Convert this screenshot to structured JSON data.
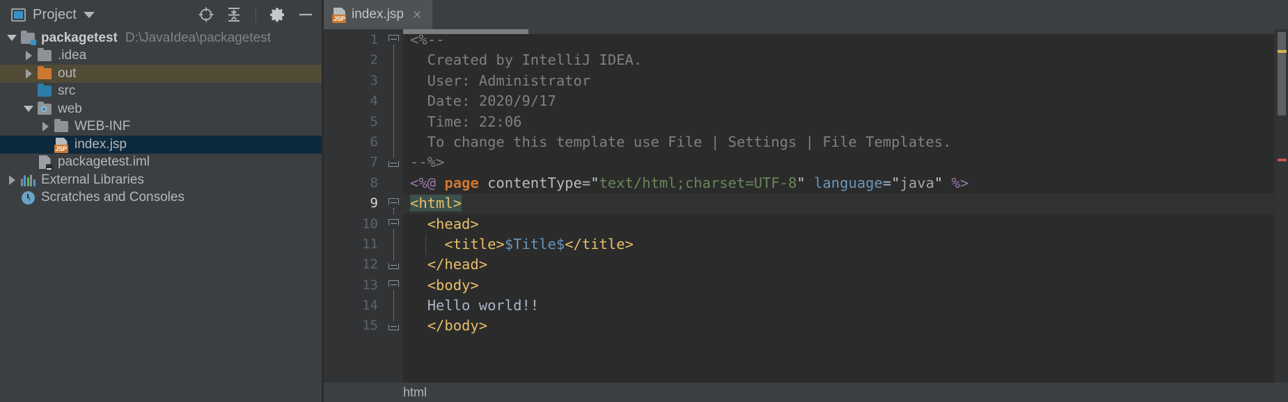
{
  "project_panel": {
    "title": "Project",
    "window_icon": "project-window-icon",
    "actions": [
      {
        "name": "locate-icon",
        "label": "Select Opened File"
      },
      {
        "name": "collapse-all-icon",
        "label": "Collapse All"
      },
      {
        "name": "gear-icon",
        "label": "Settings"
      },
      {
        "name": "minimize-icon",
        "label": "Hide"
      }
    ],
    "tree": [
      {
        "label": "packagetest",
        "path": "D:\\JavaIdea\\packagetest",
        "icon": "module-folder-icon",
        "arrow": "down",
        "depth": 0,
        "bold": true,
        "state": "none"
      },
      {
        "label": ".idea",
        "path": "",
        "icon": "folder-gray-icon",
        "arrow": "right",
        "depth": 1,
        "bold": false,
        "state": "none"
      },
      {
        "label": "out",
        "path": "",
        "icon": "folder-orange-icon",
        "arrow": "right",
        "depth": 1,
        "bold": false,
        "state": "hover"
      },
      {
        "label": "src",
        "path": "",
        "icon": "folder-blue-icon",
        "arrow": "none",
        "depth": 1,
        "bold": false,
        "state": "none"
      },
      {
        "label": "web",
        "path": "",
        "icon": "folder-web-icon",
        "arrow": "down",
        "depth": 1,
        "bold": false,
        "state": "none"
      },
      {
        "label": "WEB-INF",
        "path": "",
        "icon": "folder-gray-icon",
        "arrow": "right",
        "depth": 2,
        "bold": false,
        "state": "none"
      },
      {
        "label": "index.jsp",
        "path": "",
        "icon": "jsp-file-icon",
        "arrow": "none",
        "depth": 2,
        "bold": false,
        "state": "selected"
      },
      {
        "label": "packagetest.iml",
        "path": "",
        "icon": "iml-file-icon",
        "arrow": "none",
        "depth": 1,
        "bold": false,
        "state": "none"
      },
      {
        "label": "External Libraries",
        "path": "",
        "icon": "library-icon",
        "arrow": "right",
        "depth": 0,
        "bold": false,
        "state": "none"
      },
      {
        "label": "Scratches and Consoles",
        "path": "",
        "icon": "scratches-icon",
        "arrow": "none",
        "depth": 0,
        "bold": false,
        "state": "none"
      }
    ]
  },
  "editor": {
    "tab": {
      "label": "index.jsp",
      "icon": "jsp-file-icon",
      "close": "×"
    },
    "current_line": 9,
    "line_numbers": [
      "1",
      "2",
      "3",
      "4",
      "5",
      "6",
      "7",
      "8",
      "9",
      "10",
      "11",
      "12",
      "13",
      "14",
      "15"
    ],
    "lines": [
      {
        "n": 1,
        "text": "<%--"
      },
      {
        "n": 2,
        "text": "  Created by IntelliJ IDEA."
      },
      {
        "n": 3,
        "text": "  User: Administrator"
      },
      {
        "n": 4,
        "text": "  Date: 2020/9/17"
      },
      {
        "n": 5,
        "text": "  Time: 22:06"
      },
      {
        "n": 6,
        "text": "  To change this template use File | Settings | File Templates."
      },
      {
        "n": 7,
        "text": "--%>"
      },
      {
        "n": 8,
        "text": "<%@ page contentType=\"text/html;charset=UTF-8\" language=\"java\" %>"
      },
      {
        "n": 9,
        "text": "<html>"
      },
      {
        "n": 10,
        "text": "<head>"
      },
      {
        "n": 11,
        "text": "    <title>$Title$</title>"
      },
      {
        "n": 12,
        "text": "</head>"
      },
      {
        "n": 13,
        "text": "<body>"
      },
      {
        "n": 14,
        "text": "Hello world!!"
      },
      {
        "n": 15,
        "text": "</body>"
      }
    ],
    "breadcrumb": "html"
  },
  "colors": {
    "panel_bg": "#3c3f41",
    "editor_bg": "#2b2b2b",
    "gutter_bg": "#313335",
    "selection": "#0d293e",
    "hover": "#514b36",
    "tag": "#e8bf6a",
    "keyword": "#cc7832",
    "string": "#6a8759",
    "comment": "#808080",
    "variable": "#6897bb",
    "brace_match": "#3b514d"
  }
}
